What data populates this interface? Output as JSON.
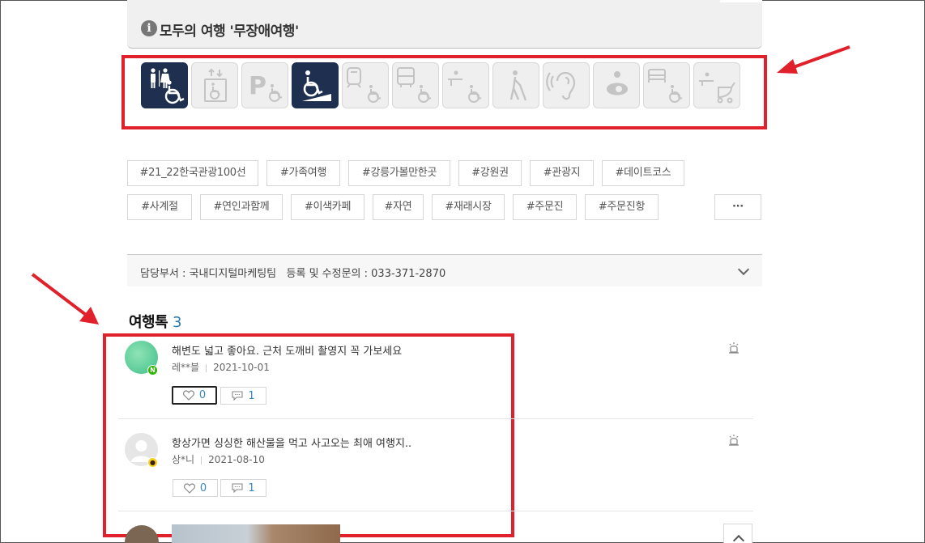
{
  "accessibility": {
    "title": "모두의 여행 '무장애여행'",
    "icons": [
      {
        "name": "accessible-restroom-icon",
        "active": true
      },
      {
        "name": "elevator-icon",
        "active": false
      },
      {
        "name": "accessible-parking-icon",
        "active": false
      },
      {
        "name": "wheelchair-ramp-icon",
        "active": true
      },
      {
        "name": "subway-access-icon",
        "active": false
      },
      {
        "name": "bus-access-icon",
        "active": false
      },
      {
        "name": "wheelchair-rental-icon",
        "active": false
      },
      {
        "name": "visually-impaired-icon",
        "active": false
      },
      {
        "name": "hearing-impaired-icon",
        "active": false
      },
      {
        "name": "nursing-room-icon",
        "active": false
      },
      {
        "name": "accessible-room-icon",
        "active": false
      },
      {
        "name": "stroller-rental-icon",
        "active": false
      }
    ]
  },
  "tags": [
    "#21_22한국관광100선",
    "#가족여행",
    "#강릉가볼만한곳",
    "#강원권",
    "#관광지",
    "#데이트코스",
    "#사계절",
    "#연인과함께",
    "#이색카페",
    "#자연",
    "#재래시장",
    "#주문진",
    "#주문진항"
  ],
  "tags_more_label": "···",
  "department": {
    "text": "담당부서 : 국내디지털마케팅팀   등록 및 수정문의 : 033-371-2870"
  },
  "travel_talk": {
    "title": "여행톡",
    "count": "3",
    "comments": [
      {
        "text": "해변도 넓고 좋아요. 근처 도깨비 촬영지 꼭 가보세요",
        "author": "레**블",
        "date": "2021-10-01",
        "likes": "0",
        "replies": "1",
        "login_badge": "N"
      },
      {
        "text": "항상가면 싱싱한 해산물을 먹고 사고오는 최애 여행지..",
        "author": "상*니",
        "date": "2021-08-10",
        "likes": "0",
        "replies": "1",
        "login_badge": "kakao"
      }
    ]
  },
  "colors": {
    "active_icon": "#1e2f4f",
    "highlight_box": "#e0212c",
    "count": "#2a7ab0"
  }
}
